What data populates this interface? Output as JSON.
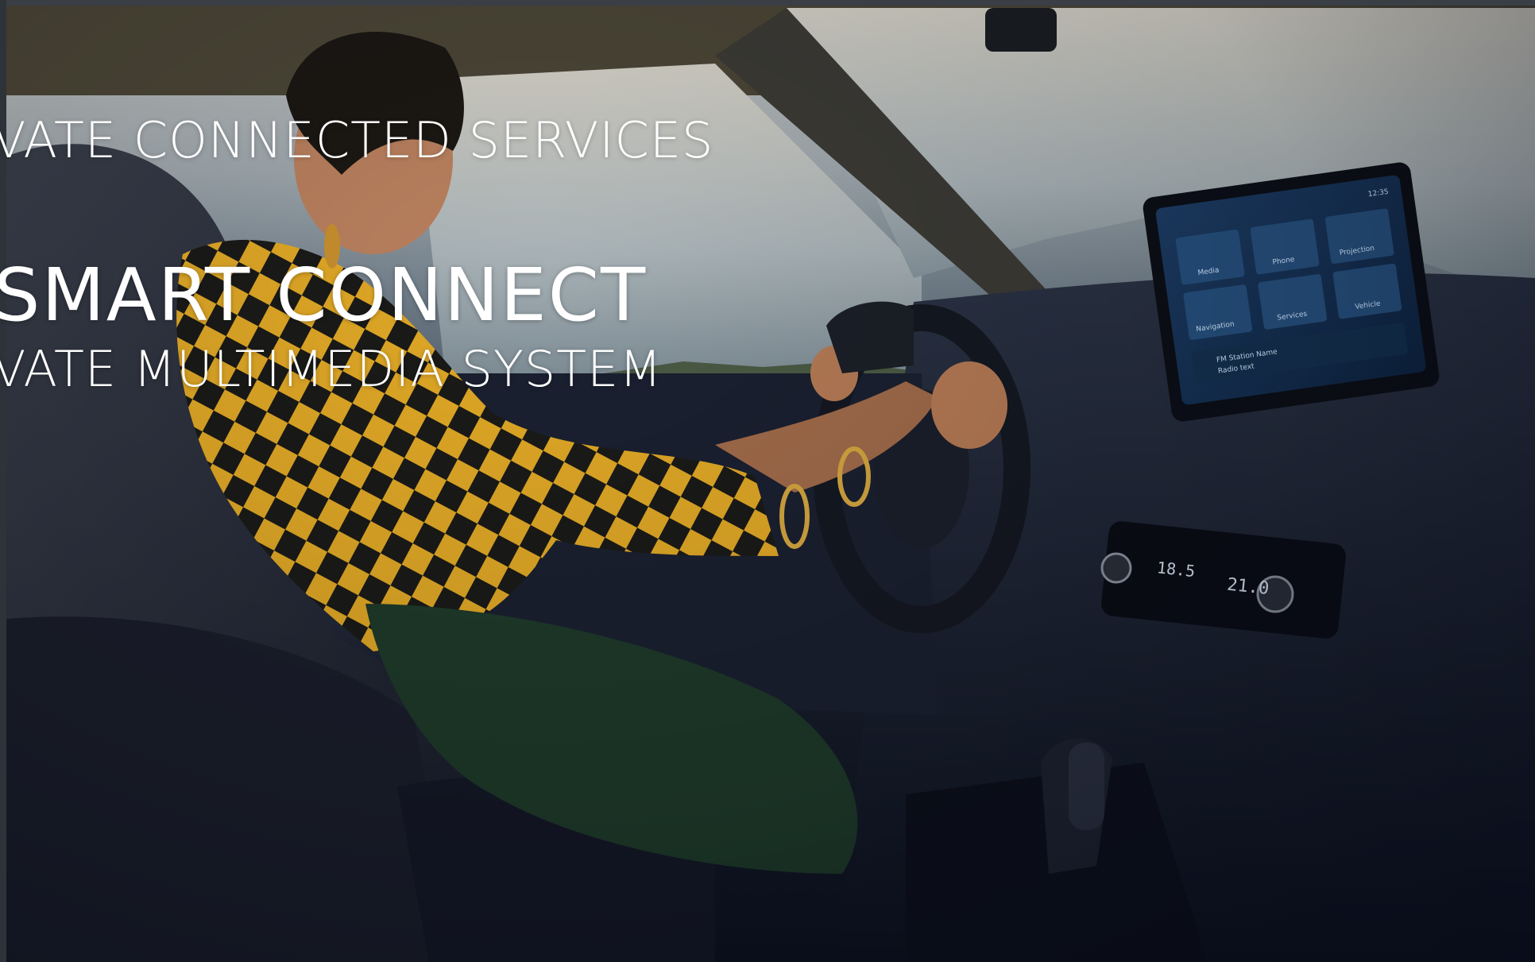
{
  "headline": {
    "line1": "VATE CONNECTED SERVICES",
    "line2": "SMART CONNECT",
    "line3": "VATE MULTIMEDIA SYSTEM"
  },
  "infotainment": {
    "clock": "12:35",
    "tiles": [
      "Media",
      "Phone",
      "Projection",
      "Navigation",
      "Services",
      "Vehicle"
    ],
    "now_playing": "FM Station Name",
    "now_playing_sub": "Radio text"
  },
  "climate": {
    "left_temp": "18.5",
    "right_temp": "21.0"
  },
  "colors": {
    "accent": "#e6b422",
    "background_dark": "#0d1220",
    "text": "#ffffff"
  }
}
